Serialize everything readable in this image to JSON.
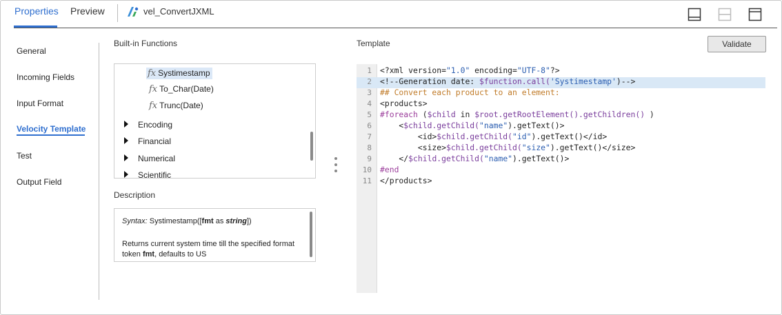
{
  "header": {
    "tabs": [
      {
        "label": "Properties",
        "active": true
      },
      {
        "label": "Preview",
        "active": false
      }
    ],
    "object_name": "vel_ConvertJXML",
    "layout_buttons": [
      "layout-bottom-icon",
      "layout-split-icon",
      "layout-top-icon"
    ]
  },
  "nav": {
    "items": [
      {
        "label": "General"
      },
      {
        "label": "Incoming Fields"
      },
      {
        "label": "Input Format"
      },
      {
        "label": "Velocity Template",
        "active": true
      },
      {
        "label": "Test"
      },
      {
        "label": "Output Field"
      }
    ]
  },
  "functions": {
    "title": "Built-in Functions",
    "fx_glyph": "fx",
    "children": [
      {
        "label": "Systimestamp",
        "selected": true
      },
      {
        "label": "To_Char(Date)"
      },
      {
        "label": "Trunc(Date)"
      }
    ],
    "groups": [
      {
        "label": "Encoding"
      },
      {
        "label": "Financial"
      },
      {
        "label": "Numerical"
      },
      {
        "label": "Scientific"
      }
    ]
  },
  "description": {
    "title": "Description",
    "syntax_label": "Syntax:",
    "syntax_fn": "Systimestamp([",
    "syntax_param": "fmt",
    "syntax_as": " as ",
    "syntax_type": "string",
    "syntax_close": "])",
    "text_pre": "Returns current system time till the specified format token ",
    "text_bold": "fmt",
    "text_post": ", defaults to US"
  },
  "template": {
    "title": "Template",
    "validate_label": "Validate",
    "highlighted_line": 2,
    "lines": [
      {
        "n": "1",
        "text": "<?xml version=\"1.0\" encoding=\"UTF-8\"?>"
      },
      {
        "n": "2",
        "text": "<!--Generation date: $function.call('Systimestamp')-->"
      },
      {
        "n": "3",
        "text": "## Convert each product to an element:"
      },
      {
        "n": "4",
        "text": "<products>"
      },
      {
        "n": "5",
        "text": "#foreach ($child in $root.getRootElement().getChildren() )"
      },
      {
        "n": "6",
        "text": "    <$child.getChild(\"name\").getText()>"
      },
      {
        "n": "7",
        "text": "        <id>$child.getChild(\"id\").getText()</id>"
      },
      {
        "n": "8",
        "text": "        <size>$child.getChild(\"size\").getText()</size>"
      },
      {
        "n": "9",
        "text": "    </$child.getChild(\"name\").getText()>"
      },
      {
        "n": "10",
        "text": "#end"
      },
      {
        "n": "11",
        "text": "</products>"
      }
    ]
  },
  "colors": {
    "accent": "#2f6fcf",
    "selection": "#dbe8f7",
    "line_highlight": "#d9e8f6",
    "comment": "#c07b29",
    "variable": "#7a3d9c",
    "string": "#2a5db0"
  }
}
